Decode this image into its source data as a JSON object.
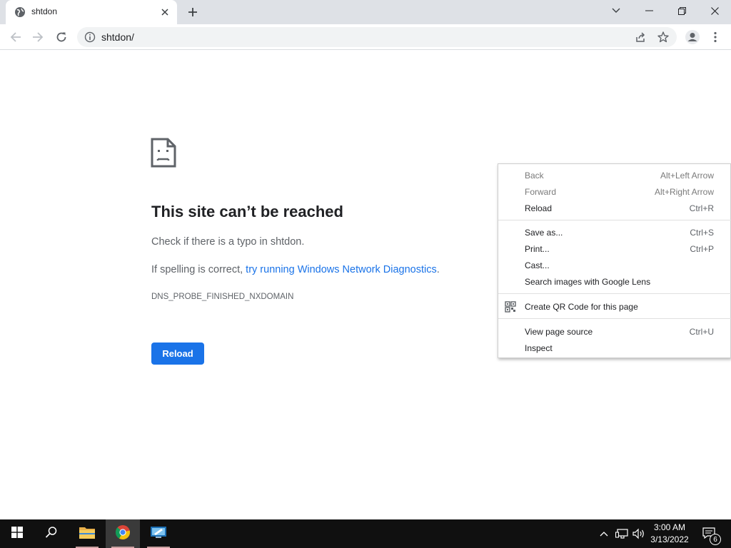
{
  "browser": {
    "tab": {
      "title": "shtdon"
    },
    "address": {
      "url": "shtdon/"
    }
  },
  "error_page": {
    "title": "This site can’t be reached",
    "line1": "Check if there is a typo in shtdon.",
    "line2_prefix": "If spelling is correct, ",
    "line2_link": "try running Windows Network Diagnostics",
    "line2_suffix": ".",
    "error_code": "DNS_PROBE_FINISHED_NXDOMAIN",
    "reload_label": "Reload"
  },
  "context_menu": {
    "items": [
      {
        "label": "Back",
        "shortcut": "Alt+Left Arrow",
        "disabled": true
      },
      {
        "label": "Forward",
        "shortcut": "Alt+Right Arrow",
        "disabled": true
      },
      {
        "label": "Reload",
        "shortcut": "Ctrl+R"
      },
      {
        "label": "Save as...",
        "shortcut": "Ctrl+S"
      },
      {
        "label": "Print...",
        "shortcut": "Ctrl+P"
      },
      {
        "label": "Cast...",
        "shortcut": ""
      },
      {
        "label": "Search images with Google Lens",
        "shortcut": ""
      },
      {
        "label": "Create QR Code for this page",
        "shortcut": "",
        "icon": "qr-code-icon"
      },
      {
        "label": "View page source",
        "shortcut": "Ctrl+U"
      },
      {
        "label": "Inspect",
        "shortcut": ""
      }
    ]
  },
  "taskbar": {
    "apps": [
      "start-icon",
      "search-icon",
      "file-explorer-icon",
      "chrome-icon",
      "remote-desktop-icon"
    ],
    "active_app": "chrome-icon",
    "clock": {
      "time": "3:00 AM",
      "date": "3/13/2022"
    },
    "notification_count": "6"
  },
  "colors": {
    "accent": "#1a73e8",
    "tabstrip": "#dee1e6",
    "taskbar": "#101010"
  }
}
